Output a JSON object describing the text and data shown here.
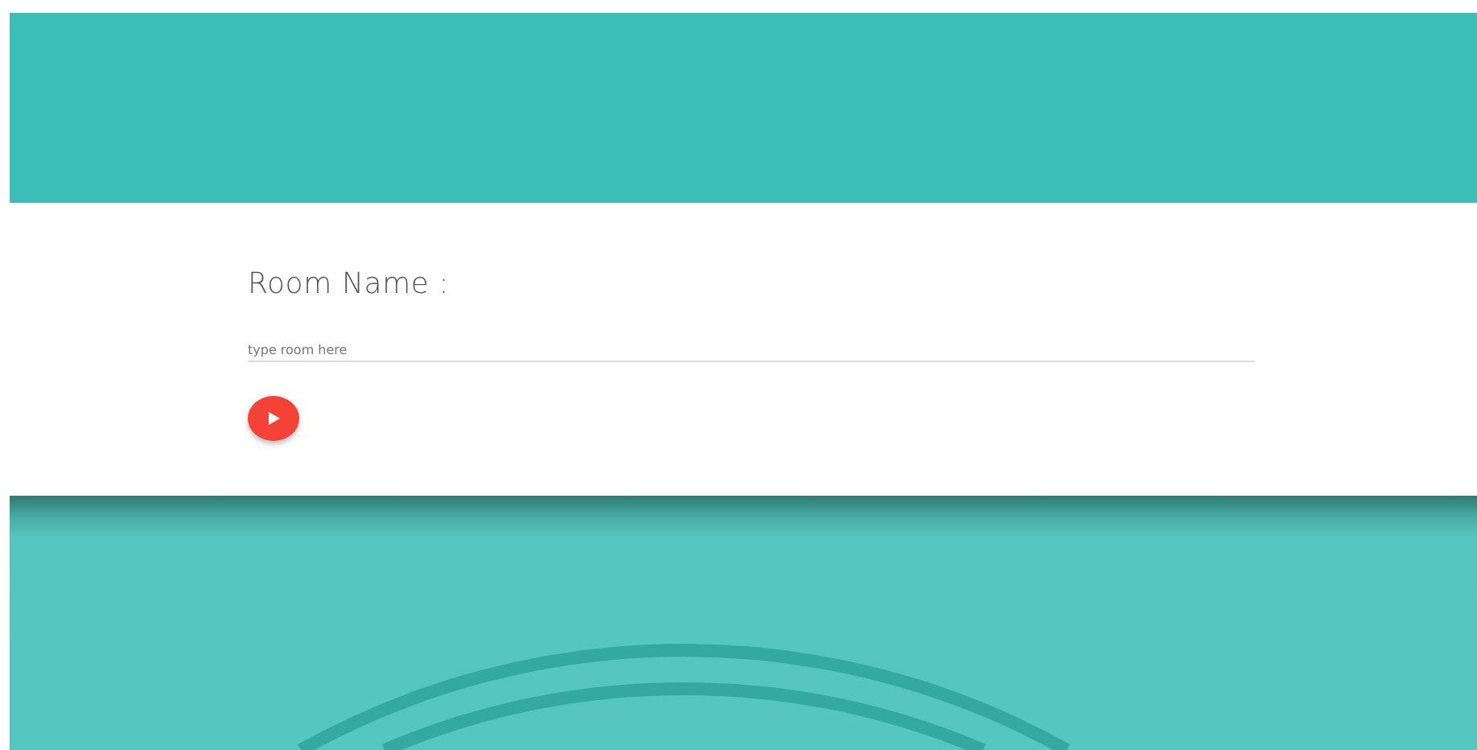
{
  "form": {
    "label": "Room Name :",
    "room_field": {
      "placeholder": "type room here"
    }
  }
}
